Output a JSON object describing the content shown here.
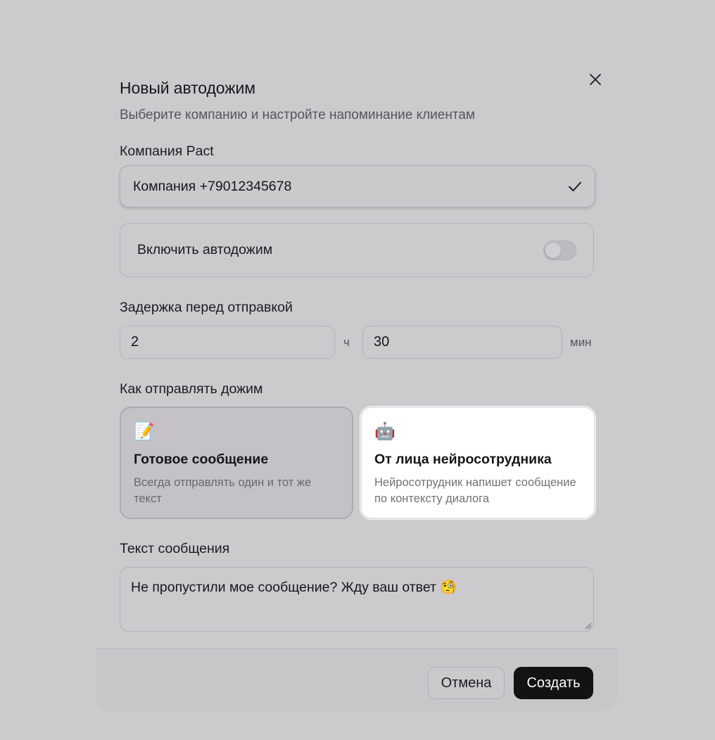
{
  "dialog": {
    "title": "Новый автодожим",
    "subtitle": "Выберите компанию и настройте напоминание клиентам",
    "close_icon": "close-icon"
  },
  "company": {
    "label": "Компания Pact",
    "selected": "Компания +79012345678",
    "selected_icon": "check-icon"
  },
  "autofollowup": {
    "label": "Включить автодожим",
    "enabled": false
  },
  "delay": {
    "label": "Задержка перед отправкой",
    "hours": "2",
    "hours_unit": "ч",
    "minutes": "30",
    "minutes_unit": "мин"
  },
  "send_mode": {
    "label": "Как отправлять дожим",
    "options": [
      {
        "emoji": "📝",
        "icon": "memo-icon",
        "title": "Готовое сообщение",
        "description": "Всегда отправлять один и тот же текст",
        "selected": false
      },
      {
        "emoji": "🤖",
        "icon": "robot-icon",
        "title": "От лица нейросотрудника",
        "description": "Нейросотрудник напишет сообщение по контексту диалога",
        "selected": true
      }
    ]
  },
  "message": {
    "label": "Текст сообщения",
    "value": "Не пропустили мое сообщение? Жду ваш ответ 🧐"
  },
  "footer": {
    "cancel_label": "Отмена",
    "create_label": "Создать"
  },
  "colors": {
    "backdrop": "#cccacd",
    "primary_button": "#131215",
    "selected_card": "#ffffff"
  }
}
